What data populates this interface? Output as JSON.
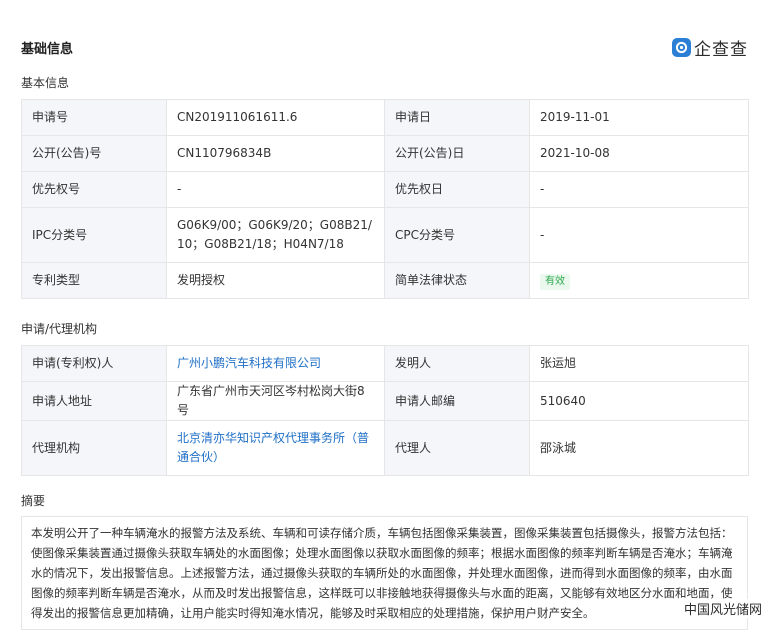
{
  "page": {
    "title": "基础信息"
  },
  "logo": {
    "text": "企查查",
    "icon": "qichacha-logo-icon",
    "color": "#2b7fd4"
  },
  "basic": {
    "heading": "基本信息",
    "rows": [
      [
        {
          "k": "申请号",
          "v": "CN201911061611.6"
        },
        {
          "k": "申请日",
          "v": "2019-11-01"
        }
      ],
      [
        {
          "k": "公开(公告)号",
          "v": "CN110796834B"
        },
        {
          "k": "公开(公告)日",
          "v": "2021-10-08"
        }
      ],
      [
        {
          "k": "优先权号",
          "v": "-"
        },
        {
          "k": "优先权日",
          "v": "-"
        }
      ],
      [
        {
          "k": "IPC分类号",
          "v": "G06K9/00；G06K9/20；G08B21/10；G08B21/18；H04N7/18"
        },
        {
          "k": "CPC分类号",
          "v": "-"
        }
      ],
      [
        {
          "k": "专利类型",
          "v": "发明授权"
        },
        {
          "k": "简单法律状态",
          "v": "有效"
        }
      ]
    ]
  },
  "agency": {
    "heading": "申请/代理机构",
    "rows": [
      [
        {
          "k": "申请(专利权)人",
          "v": "广州小鹏汽车科技有限公司"
        },
        {
          "k": "发明人",
          "v": "张运旭"
        }
      ],
      [
        {
          "k": "申请人地址",
          "v": "广东省广州市天河区岑村松岗大街8号"
        },
        {
          "k": "申请人邮编",
          "v": "510640"
        }
      ],
      [
        {
          "k": "代理机构",
          "v": "北京清亦华知识产权代理事务所（普通合伙）"
        },
        {
          "k": "代理人",
          "v": "邵泳城"
        }
      ]
    ]
  },
  "abstract": {
    "heading": "摘要",
    "text": "本发明公开了一种车辆淹水的报警方法及系统、车辆和可读存储介质，车辆包括图像采集装置，图像采集装置包括摄像头，报警方法包括：使图像采集装置通过摄像头获取车辆处的水面图像；处理水面图像以获取水面图像的频率；根据水面图像的频率判断车辆是否淹水；车辆淹水的情况下，发出报警信息。上述报警方法，通过摄像头获取的车辆所处的水面图像，并处理水面图像，进而得到水面图像的频率，由水面图像的频率判断车辆是否淹水，从而及时发出报警信息，这样既可以非接触地获得摄像头与水面的距离，又能够有效地区分水面和地面，使得发出的报警信息更加精确，让用户能实时得知淹水情况，能够及时采取相应的处理措施，保护用户财产安全。"
  },
  "watermark": {
    "text": "中国风光储网"
  },
  "colors": {
    "key_bg": "#f4f6f9",
    "border": "#e6e6e6",
    "link": "#1f6fc6",
    "badge_text": "#2ea84f",
    "badge_bg": "#eaf8ee"
  }
}
